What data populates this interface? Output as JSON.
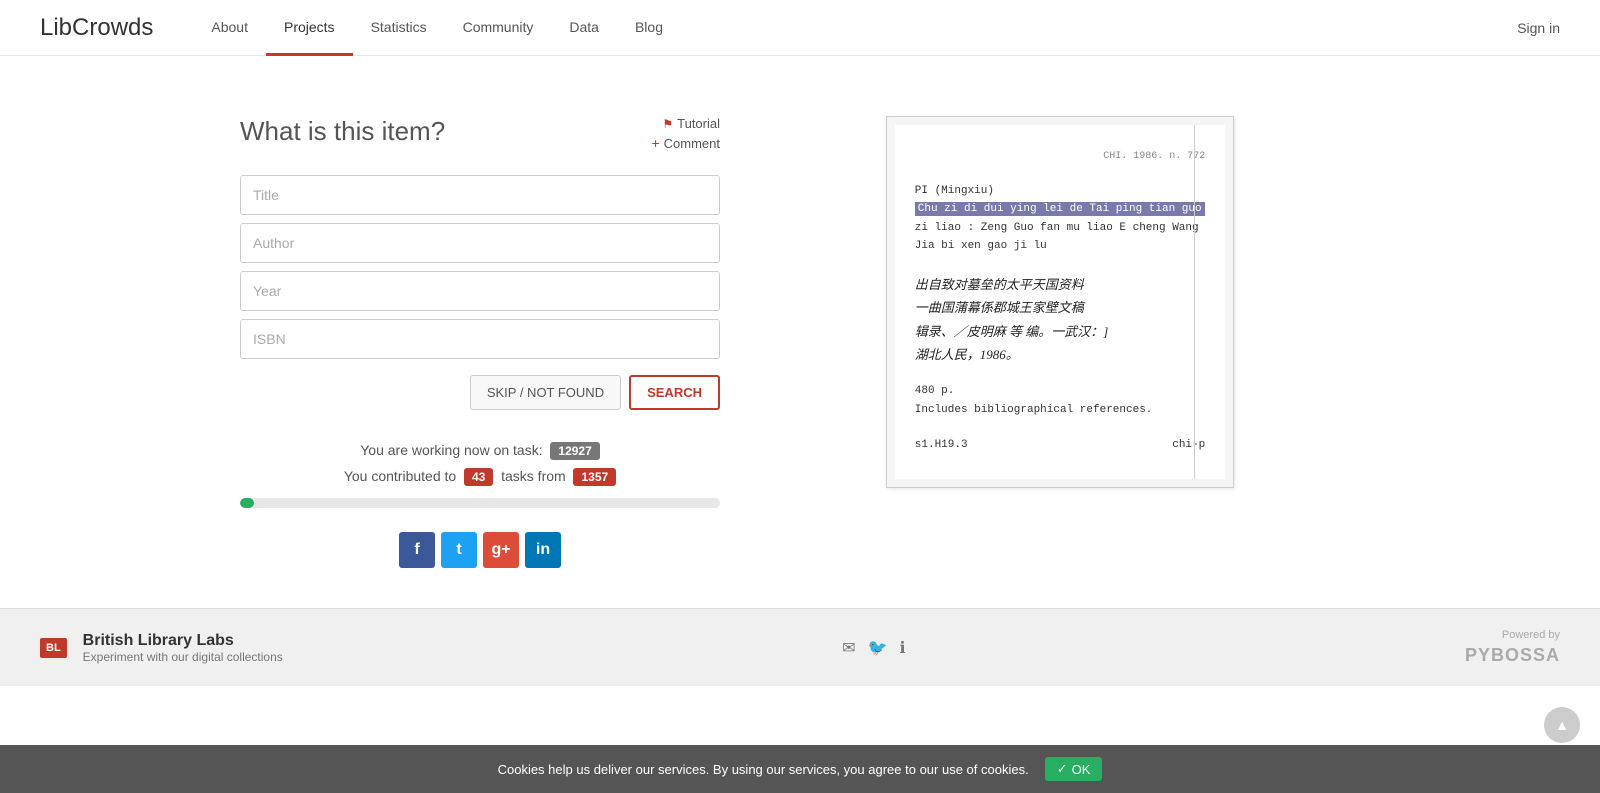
{
  "site": {
    "logo": "LibCrowds",
    "sign_in": "Sign in"
  },
  "nav": {
    "items": [
      {
        "id": "about",
        "label": "About",
        "active": false
      },
      {
        "id": "projects",
        "label": "Projects",
        "active": true
      },
      {
        "id": "statistics",
        "label": "Statistics",
        "active": false
      },
      {
        "id": "community",
        "label": "Community",
        "active": false
      },
      {
        "id": "data",
        "label": "Data",
        "active": false
      },
      {
        "id": "blog",
        "label": "Blog",
        "active": false
      }
    ]
  },
  "form": {
    "title": "What is this item?",
    "tutorial_label": "Tutorial",
    "comment_label": "Comment",
    "fields": [
      {
        "id": "title",
        "placeholder": "Title"
      },
      {
        "id": "author",
        "placeholder": "Author"
      },
      {
        "id": "year",
        "placeholder": "Year"
      },
      {
        "id": "isbn",
        "placeholder": "ISBN"
      }
    ],
    "skip_label": "SKIP / NOT FOUND",
    "search_label": "SEARCH"
  },
  "task": {
    "working_text": "You are working now on task:",
    "task_id": "12927",
    "contributed_text": "You contributed to",
    "contributed_count": "43",
    "tasks_from_text": "tasks from",
    "tasks_total": "1357",
    "progress_percent": 3
  },
  "social": {
    "facebook_icon": "f",
    "twitter_icon": "t",
    "google_icon": "g+",
    "linkedin_icon": "in"
  },
  "document": {
    "line1": "CHI. 1986. n. 772",
    "line2": "PI (Mingxiu)",
    "line3_highlight": "Chu zi di dui ying lei de Tai ping tian guo",
    "line4": "zi liao : Zeng Guo fan mu liao E cheng Wang",
    "line5": "Jia bi xen gao ji lu",
    "handwritten1": "出自致对墓垒的太平天国资料",
    "handwritten2": "一曲国蒲幕係郡城王家壁文稿",
    "handwritten3": "辑录、／皮明麻 等 编。一武汉：]",
    "handwritten4": "湖北人民，1986。",
    "line_480": "480 p.",
    "line_bib": "Includes bibliographical references.",
    "line_call": "s1.H19.3",
    "line_chi": "chi-p"
  },
  "footer": {
    "bl_badge": "BRITISH LIBRARY",
    "brand_name": "British Library Labs",
    "brand_sub": "Experiment with our digital collections",
    "powered_by": "Powered by",
    "pybossa": "PYBOSSA"
  },
  "cookie": {
    "text": "Cookies help us deliver our services. By using our services, you agree to our use of cookies.",
    "ok_label": "OK"
  }
}
